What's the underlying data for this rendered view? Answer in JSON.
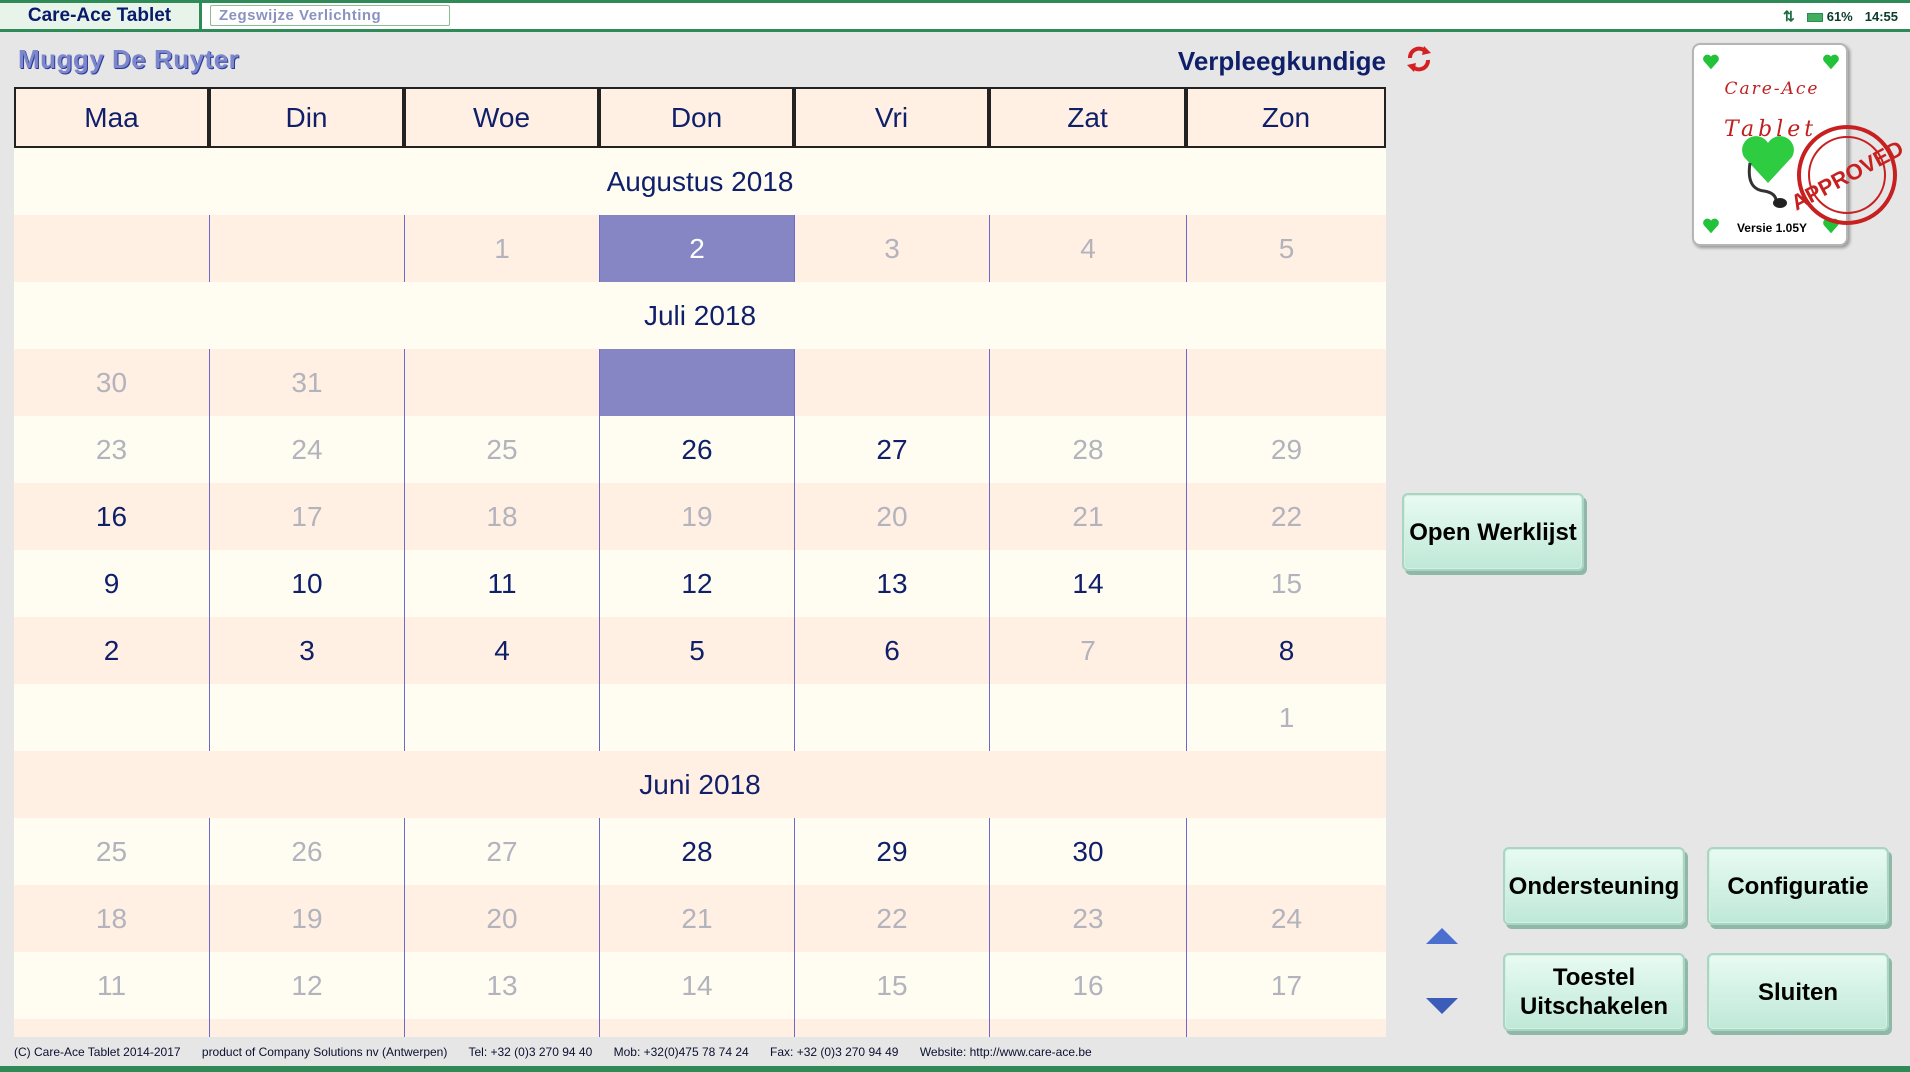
{
  "app": {
    "title": "Care-Ace Tablet",
    "tab2_label": "Zegswijze Verlichting"
  },
  "status": {
    "battery": "61%",
    "time": "14:55"
  },
  "header": {
    "user_name": "Muggy De Ruyter",
    "role": "Verpleegkundige"
  },
  "days": [
    "Maa",
    "Din",
    "Woe",
    "Don",
    "Vri",
    "Zat",
    "Zon"
  ],
  "calendar": {
    "aug_title": "Augustus 2018",
    "aug_r1": [
      "",
      "",
      "1",
      "2",
      "3",
      "4",
      "5"
    ],
    "jul_title": "Juli 2018",
    "jul_r1": [
      "30",
      "31",
      "",
      "",
      "",
      "",
      ""
    ],
    "jul_r2": [
      "23",
      "24",
      "25",
      "26",
      "27",
      "28",
      "29"
    ],
    "jul_r3": [
      "16",
      "17",
      "18",
      "19",
      "20",
      "21",
      "22"
    ],
    "jul_r4": [
      "9",
      "10",
      "11",
      "12",
      "13",
      "14",
      "15"
    ],
    "jul_r5": [
      "2",
      "3",
      "4",
      "5",
      "6",
      "7",
      "8"
    ],
    "jul_r6": [
      "",
      "",
      "",
      "",
      "",
      "",
      "1"
    ],
    "jun_title": "Juni 2018",
    "jun_r1": [
      "25",
      "26",
      "27",
      "28",
      "29",
      "30",
      ""
    ],
    "jun_r2": [
      "18",
      "19",
      "20",
      "21",
      "22",
      "23",
      "24"
    ],
    "jun_r3": [
      "11",
      "12",
      "13",
      "14",
      "15",
      "16",
      "17"
    ]
  },
  "logo": {
    "name": "Care-Ace",
    "sub": "Tablet",
    "stamp": "APPROVED",
    "version": "Versie 1.05Y"
  },
  "buttons": {
    "open_worklist": "Open Werklijst",
    "support": "Ondersteuning",
    "config": "Configuratie",
    "shutdown_line1": "Toestel",
    "shutdown_line2": "Uitschakelen",
    "close": "Sluiten"
  },
  "footer": {
    "copyright": "(C) Care-Ace Tablet 2014-2017",
    "product": "product of Company Solutions nv (Antwerpen)",
    "tel": "Tel: +32 (0)3 270 94 40",
    "mob": "Mob: +32(0)475 78 74 24",
    "fax": "Fax: +32 (0)3 270 94 49",
    "website": "Website: http://www.care-ace.be"
  }
}
